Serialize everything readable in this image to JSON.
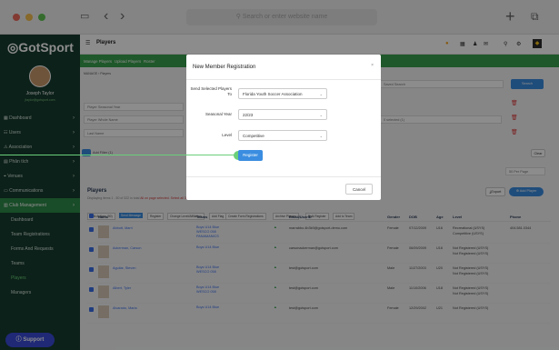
{
  "browser": {
    "url_placeholder": "Search or enter website name"
  },
  "sidebar": {
    "logo": "GotSport",
    "user_name": "Joseph Taylor",
    "user_email": "jtaylor@gotsport.com",
    "items": [
      {
        "label": "Dashboard"
      },
      {
        "label": "Users"
      },
      {
        "label": "Association"
      },
      {
        "label": "Phân tích"
      },
      {
        "label": "Venues"
      },
      {
        "label": "Communications"
      },
      {
        "label": "Club Management"
      },
      {
        "label": "Dashboard"
      },
      {
        "label": "Team Registrations"
      },
      {
        "label": "Forms And Requests"
      },
      {
        "label": "Teams"
      },
      {
        "label": "Players"
      },
      {
        "label": "Managers"
      }
    ],
    "support": "Support"
  },
  "header": {
    "title": "Players"
  },
  "tabs": [
    "Manage Players",
    "Upload Players",
    "Roster"
  ],
  "breadcrumb": [
    "MANAGE",
    "Players"
  ],
  "filters": {
    "saved_search": "Saved Search",
    "search_button": "Search",
    "season_placeholder": "Player Seasonal Year",
    "name_placeholder": "Player Whole Name",
    "last_name_placeholder": "Last Name",
    "selected": "0 selected (1)",
    "add_filter": "Add Filter (1)",
    "clear": "Clear",
    "per_page": "50 Per Page"
  },
  "players_section": {
    "title": "Players",
    "subtitle": "Displaying items 1 - 50 of 322 in total",
    "warning": "All on page selected. Select all 322 players in this search",
    "export": "Export",
    "add_player": "Add Player",
    "toolbar": [
      "Bulk Actions (50)",
      "Send Message",
      "Register",
      "Change Level/Affiliation",
      "Add Flag",
      "Create Form Registrations",
      "Archive Players",
      "Bulk Register",
      "Add to Team"
    ]
  },
  "table": {
    "columns": [
      "Name",
      "Teams",
      "Email/UserID",
      "Gender",
      "DOB",
      "Age",
      "Level",
      "Phone"
    ],
    "rows": [
      {
        "name": "Abbott, Marri",
        "teams": [
          "Boys U14 Blue",
          "WESCO 058",
          "PANAMANICS"
        ],
        "email": "marrabbo.4b3k9@gotsport-demo.com",
        "gender": "Female",
        "dob": "07/12/2009",
        "age": "U16",
        "level": "Recreational (USYS)",
        "level2": "Competitive (USYS)",
        "phone": "404.581.0344"
      },
      {
        "name": "Ackerman, Carson",
        "teams": [
          "Boys U14 Blue"
        ],
        "email": "carsonackerman@gotsport.com",
        "gender": "Female",
        "dob": "06/09/2009",
        "age": "U16",
        "level": "Not Registered (USYS)",
        "level2": "Not Registered (USYS)",
        "phone": ""
      },
      {
        "name": "Aguilar, Steven",
        "teams": [
          "Boys U14 Blue",
          "WESCO 058"
        ],
        "email": "test@gotsport.com",
        "gender": "Male",
        "dob": "11/27/2003",
        "age": "U20",
        "level": "Not Registered (USYS)",
        "level2": "Not Registered (USYS)",
        "phone": ""
      },
      {
        "name": "Albert, Tyler",
        "teams": [
          "Boys U14 Blue",
          "WESCO 058"
        ],
        "email": "test@gotsport.com",
        "gender": "Male",
        "dob": "11/10/2006",
        "age": "U18",
        "level": "Not Registered (USYS)",
        "level2": "Not Registered (USYS)",
        "phone": ""
      },
      {
        "name": "Alvarado, Maria",
        "teams": [
          "Boys U14 Blue"
        ],
        "email": "test@gotsport.com",
        "gender": "Female",
        "dob": "12/29/2002",
        "age": "U21",
        "level": "Not Registered (USYS)",
        "level2": "",
        "phone": ""
      }
    ]
  },
  "modal": {
    "title": "New Member Registration",
    "close": "×",
    "fields": [
      {
        "label": "Send Selected Players To",
        "value": "Florida Youth Soccer Association"
      },
      {
        "label": "Seasonal Year",
        "value": "22/23"
      },
      {
        "label": "Level",
        "value": "Competitive"
      }
    ],
    "register_button": "Register",
    "cancel_button": "Cancel"
  }
}
